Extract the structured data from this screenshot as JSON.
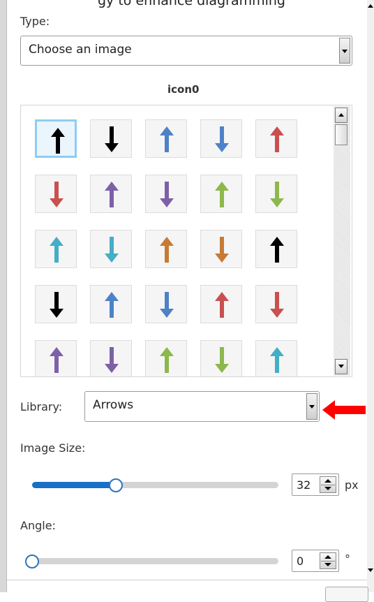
{
  "clipped_top_text": "gy to enhance diagramming",
  "type": {
    "label": "Type:",
    "selected": "Choose an image"
  },
  "icon_title": "icon0",
  "icons": [
    {
      "name": "arrow-up-icon",
      "dir": "up",
      "color": "#000000",
      "selected": true
    },
    {
      "name": "arrow-down-icon",
      "dir": "down",
      "color": "#000000"
    },
    {
      "name": "arrow-up-icon",
      "dir": "up",
      "color": "#4f81c7"
    },
    {
      "name": "arrow-down-icon",
      "dir": "down",
      "color": "#4f81c7"
    },
    {
      "name": "arrow-up-icon",
      "dir": "up",
      "color": "#c9504f"
    },
    {
      "name": "arrow-down-icon",
      "dir": "down",
      "color": "#c9504f"
    },
    {
      "name": "arrow-up-icon",
      "dir": "up",
      "color": "#7d60a8"
    },
    {
      "name": "arrow-down-icon",
      "dir": "down",
      "color": "#7d60a8"
    },
    {
      "name": "arrow-up-icon",
      "dir": "up",
      "color": "#8cb84c"
    },
    {
      "name": "arrow-down-icon",
      "dir": "down",
      "color": "#8cb84c"
    },
    {
      "name": "arrow-up-icon",
      "dir": "up",
      "color": "#44aec6"
    },
    {
      "name": "arrow-down-icon",
      "dir": "down",
      "color": "#44aec6"
    },
    {
      "name": "arrow-up-icon",
      "dir": "up",
      "color": "#c87a35"
    },
    {
      "name": "arrow-down-icon",
      "dir": "down",
      "color": "#c87a35"
    },
    {
      "name": "arrow-up-icon",
      "dir": "up",
      "color": "#000000"
    },
    {
      "name": "arrow-down-icon",
      "dir": "down",
      "color": "#000000"
    },
    {
      "name": "arrow-up-icon",
      "dir": "up",
      "color": "#4f81c7"
    },
    {
      "name": "arrow-down-icon",
      "dir": "down",
      "color": "#4f81c7"
    },
    {
      "name": "arrow-up-icon",
      "dir": "up",
      "color": "#c9504f"
    },
    {
      "name": "arrow-down-icon",
      "dir": "down",
      "color": "#c9504f"
    },
    {
      "name": "arrow-up-icon",
      "dir": "up",
      "color": "#7d60a8"
    },
    {
      "name": "arrow-down-icon",
      "dir": "down",
      "color": "#7d60a8"
    },
    {
      "name": "arrow-up-icon",
      "dir": "up",
      "color": "#8cb84c"
    },
    {
      "name": "arrow-down-icon",
      "dir": "down",
      "color": "#8cb84c"
    },
    {
      "name": "arrow-up-icon",
      "dir": "up",
      "color": "#44aec6"
    }
  ],
  "library": {
    "label": "Library:",
    "selected": "Arrows"
  },
  "image_size": {
    "label": "Image Size:",
    "value": "32",
    "unit": "px",
    "slider_fraction": 0.34
  },
  "angle": {
    "label": "Angle:",
    "value": "0",
    "unit": "°",
    "slider_fraction": 0.0
  },
  "colors": {
    "accent": "#1a6fc6",
    "annotation_arrow": "#ff0000",
    "selection": "#8dcdf3"
  }
}
